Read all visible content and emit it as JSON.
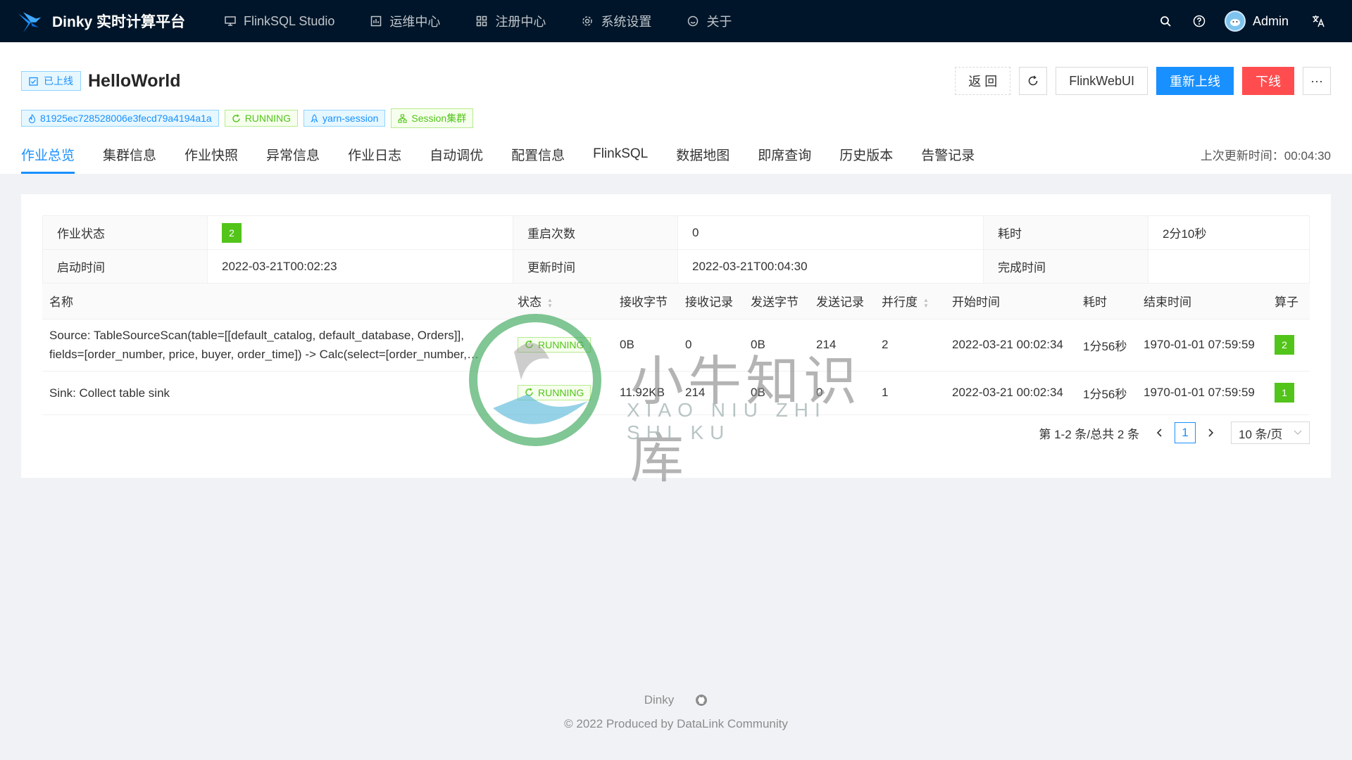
{
  "nav": {
    "brand": "Dinky 实时计算平台",
    "menu": [
      "FlinkSQL Studio",
      "运维中心",
      "注册中心",
      "系统设置",
      "关于"
    ],
    "username": "Admin",
    "colors": {
      "bg": "#001529",
      "accent": "#1890ff"
    }
  },
  "header": {
    "status_tag": "已上线",
    "title": "HelloWorld",
    "buttons": {
      "back": "返 回",
      "flink_web_ui": "FlinkWebUI",
      "relaunch": "重新上线",
      "offline": "下线",
      "more": "···"
    },
    "tags": [
      "81925ec728528006e3fecd79a4194a1a",
      "RUNNING",
      "yarn-session",
      "Session集群"
    ],
    "tabs": [
      "作业总览",
      "集群信息",
      "作业快照",
      "异常信息",
      "作业日志",
      "自动调优",
      "配置信息",
      "FlinkSQL",
      "数据地图",
      "即席查询",
      "历史版本",
      "告警记录"
    ],
    "last_update": "上次更新时间：00:04:30"
  },
  "summary": {
    "row1": {
      "l1": "作业状态",
      "v1": "2",
      "l2": "重启次数",
      "v2": "0",
      "l3": "耗时",
      "v3": "2分10秒"
    },
    "row2": {
      "l1": "启动时间",
      "v1": "2022-03-21T00:02:23",
      "l2": "更新时间",
      "v2": "2022-03-21T00:04:30",
      "l3": "完成时间",
      "v3": ""
    }
  },
  "operators": {
    "columns": [
      "名称",
      "状态",
      "接收字节",
      "接收记录",
      "发送字节",
      "发送记录",
      "并行度",
      "开始时间",
      "耗时",
      "结束时间",
      "算子"
    ],
    "rows": [
      {
        "name": "Source: TableSourceScan(table=[[default_catalog, default_database, Orders]], fields=[order_number, price, buyer, order_time]) -> Calc(select=[order_number, price, buyer, order_time])",
        "status": "RUNNING",
        "recv_bytes": "0B",
        "recv_records": "0",
        "sent_bytes": "0B",
        "sent_records": "214",
        "parallelism": "2",
        "start": "2022-03-21 00:02:34",
        "duration": "1分56秒",
        "end": "1970-01-01 07:59:59",
        "tasks": "2"
      },
      {
        "name": "Sink: Collect table sink",
        "status": "RUNNING",
        "recv_bytes": "11.92KB",
        "recv_records": "214",
        "sent_bytes": "0B",
        "sent_records": "0",
        "parallelism": "1",
        "start": "2022-03-21 00:02:34",
        "duration": "1分56秒",
        "end": "1970-01-01 07:59:59",
        "tasks": "1"
      }
    ]
  },
  "pagination": {
    "total_text": "第 1-2 条/总共 2 条",
    "current": "1",
    "page_size": "10 条/页"
  },
  "watermark": {
    "cn": "小牛知识库",
    "en": "XIAO NIU ZHI SHI KU"
  },
  "footer": {
    "link": "Dinky",
    "copyright": "© 2022 Produced by DataLink Community"
  }
}
